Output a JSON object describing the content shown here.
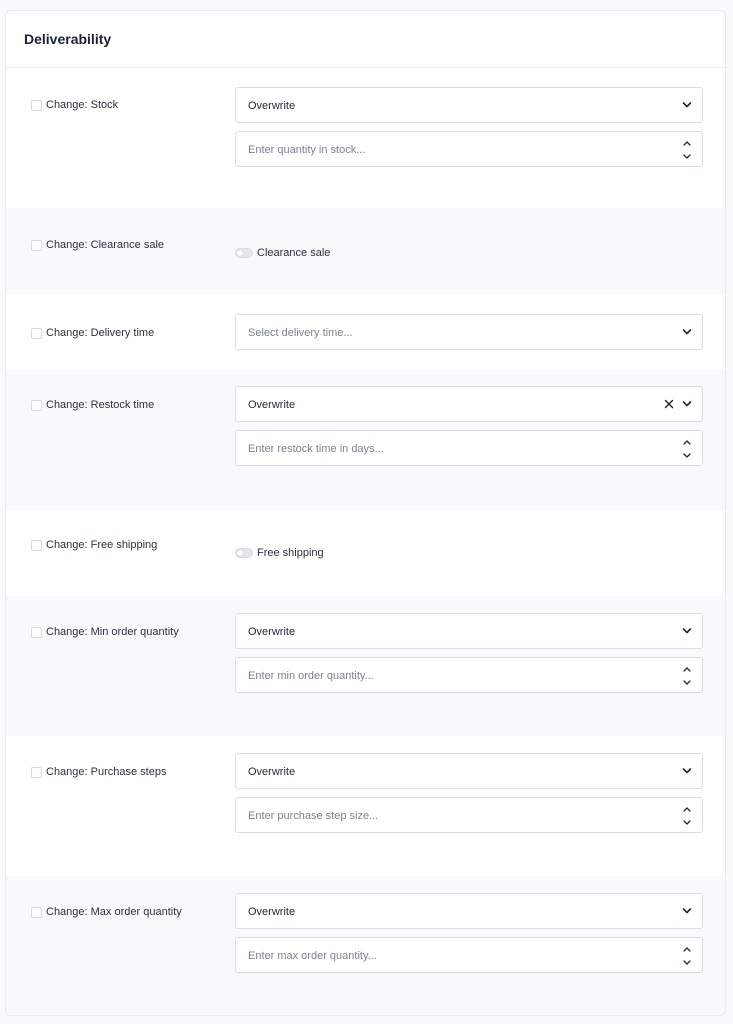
{
  "title": "Deliverability",
  "rows": {
    "stock": {
      "label": "Change: Stock",
      "select": "Overwrite",
      "placeholder": "Enter quantity in stock..."
    },
    "clearance": {
      "label": "Change: Clearance sale",
      "toggle": "Clearance sale"
    },
    "delivery": {
      "label": "Change: Delivery time",
      "placeholder": "Select delivery time..."
    },
    "restock": {
      "label": "Change: Restock time",
      "select": "Overwrite",
      "placeholder": "Enter restock time in days..."
    },
    "shipping": {
      "label": "Change: Free shipping",
      "toggle": "Free shipping"
    },
    "min_order": {
      "label": "Change: Min order quantity",
      "select": "Overwrite",
      "placeholder": "Enter min order quantity..."
    },
    "purchase_steps": {
      "label": "Change: Purchase steps",
      "select": "Overwrite",
      "placeholder": "Enter purchase step size..."
    },
    "max_order": {
      "label": "Change: Max order quantity",
      "select": "Overwrite",
      "placeholder": "Enter max order quantity..."
    }
  },
  "colors": {
    "card_bg": "#ffffff",
    "alt_row_bg": "#f8f9fb",
    "border": "#dbdfe5",
    "text": "#1f2937",
    "placeholder": "#7b8290"
  }
}
